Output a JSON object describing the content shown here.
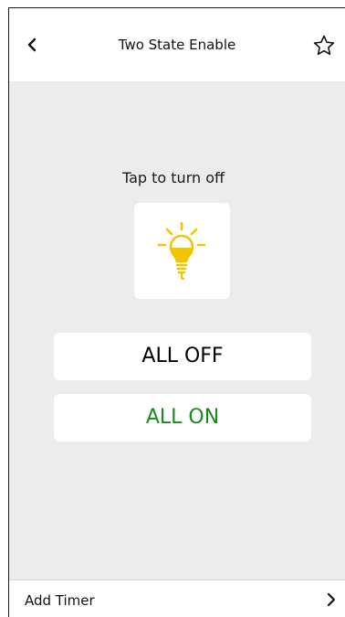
{
  "header": {
    "title": "Two State Enable",
    "back_icon": "chevron-left-icon",
    "favorite_icon": "star-outline-icon"
  },
  "main": {
    "hint": "Tap to turn off",
    "bulb": {
      "icon": "lightbulb-icon",
      "state": "on",
      "color": "#F5C400"
    },
    "buttons": {
      "all_off_label": "ALL OFF",
      "all_on_label": "ALL ON"
    }
  },
  "footer": {
    "label": "Add Timer",
    "chevron_icon": "chevron-right-icon"
  },
  "colors": {
    "background": "#ECECEC",
    "surface": "#FFFFFF",
    "accent_on": "#1A8A1A",
    "bulb": "#F5C400"
  }
}
